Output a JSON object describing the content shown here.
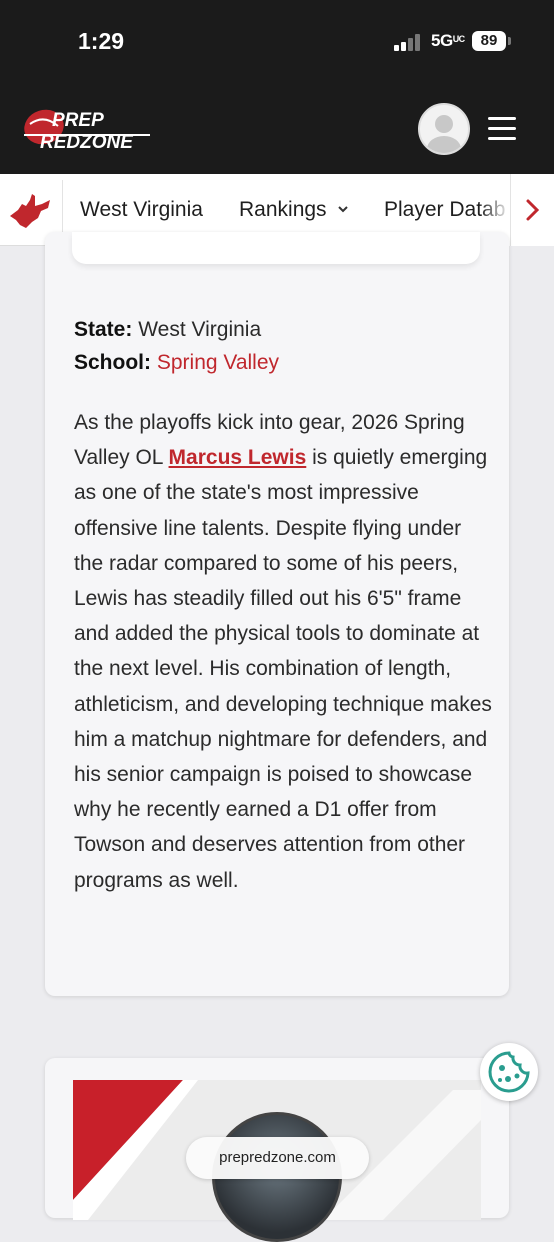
{
  "status_bar": {
    "time": "1:29",
    "network": "5G",
    "network_suffix": "UC",
    "battery": "89"
  },
  "header": {
    "logo_line1": "PREP",
    "logo_line2": "REDZONE",
    "avatar_icon": "user-avatar-icon",
    "menu_icon": "hamburger-menu-icon"
  },
  "subnav": {
    "state_icon": "west-virginia-map-icon",
    "items": [
      {
        "label": "West Virginia"
      },
      {
        "label": "Rankings"
      },
      {
        "label": "Player Datab"
      }
    ],
    "next_icon": "chevron-right-icon"
  },
  "article": {
    "state_label": "State:",
    "state_value": "West Virginia",
    "school_label": "School:",
    "school_value": "Spring Valley",
    "body_before_link": "As the playoffs kick into gear, 2026 Spring Valley OL ",
    "player_link": "Marcus Lewis",
    "body_after_link": " is quietly emerging as one of the state's most impressive offensive line talents. Despite flying under the radar compared to some of his peers, Lewis has steadily filled out his 6'5\" frame and added the physical tools to dominate at the next level. His combination of length, athleticism, and developing technique makes him a matchup nightmare for defenders, and his senior campaign is poised to showcase why he recently earned a D1 offer from Towson and deserves attention from other programs as well."
  },
  "footer": {
    "url": "prepredzone.com",
    "cookie_icon": "cookie-icon"
  },
  "colors": {
    "brand_red": "#c0272d",
    "header_bg": "#1b1b1b",
    "page_bg": "#ececef"
  }
}
